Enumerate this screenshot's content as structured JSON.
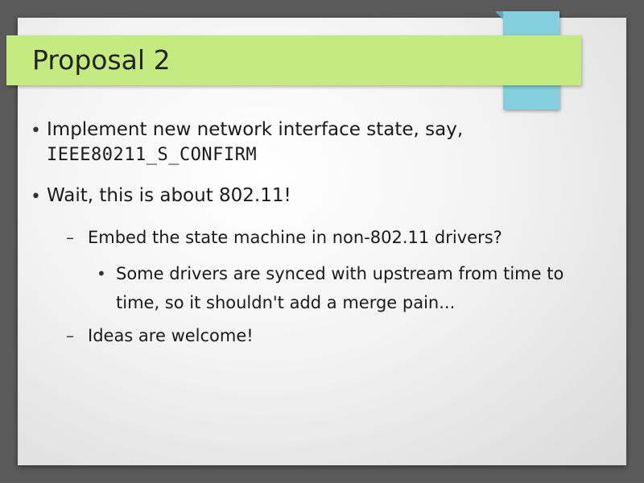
{
  "slide": {
    "title": "Proposal 2",
    "items": [
      {
        "bullet": "•",
        "text": "Implement new network interface state, say,",
        "code": "IEEE80211_S_CONFIRM"
      },
      {
        "bullet": "•",
        "text": "Wait, this is about 802.11!"
      },
      {
        "bullet": "–",
        "text": "Embed the state machine in non-802.11 drivers?"
      },
      {
        "bullet": "•",
        "text_line1": "Some drivers are synced with upstream from time to",
        "text_line2": "time, so it shouldn't add a merge pain..."
      },
      {
        "bullet": "–",
        "text": "Ideas are welcome!"
      }
    ]
  },
  "colors": {
    "title_bar": "#c5ea80",
    "accent_tab": "#84cfdd",
    "frame": "#5a5a5a"
  }
}
